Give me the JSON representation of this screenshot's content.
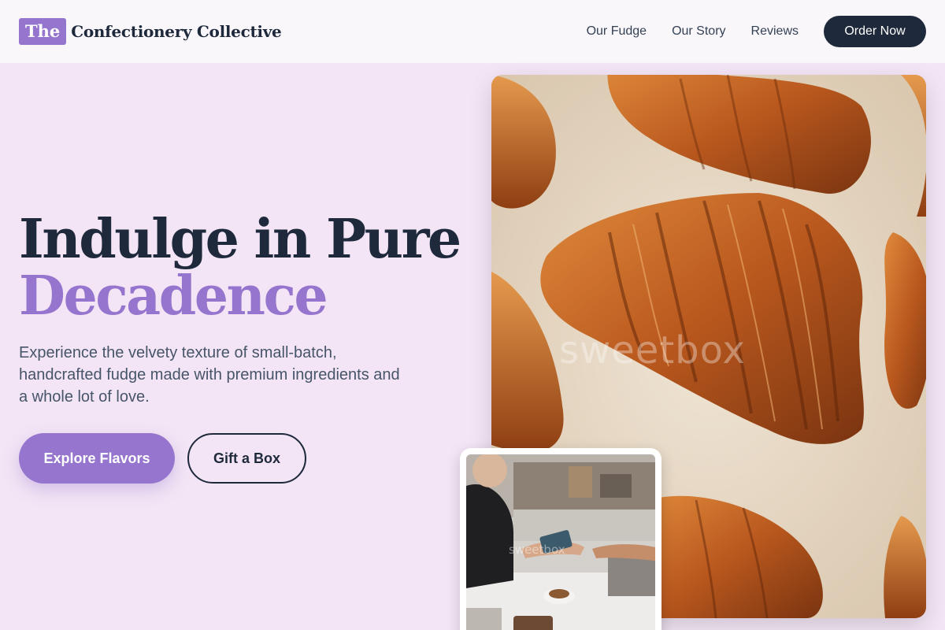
{
  "brand": {
    "badge": "The",
    "name": "Confectionery Collective"
  },
  "nav": {
    "links": [
      "Our Fudge",
      "Our Story",
      "Reviews"
    ],
    "cta": "Order Now"
  },
  "hero": {
    "title_line1": "Indulge in Pure",
    "title_line2": "Decadence",
    "description": "Experience the velvety texture of small-batch, handcrafted fudge made with premium ingredients and a whole lot of love.",
    "primary_button": "Explore Flavors",
    "secondary_button": "Gift a Box"
  },
  "images": {
    "main_watermark": "sweetbox",
    "inset_watermark": "sweetbox"
  },
  "colors": {
    "background": "#f3e5f5",
    "accent": "#9575cd",
    "dark": "#1e293b",
    "nav_background": "#faf7fb"
  }
}
